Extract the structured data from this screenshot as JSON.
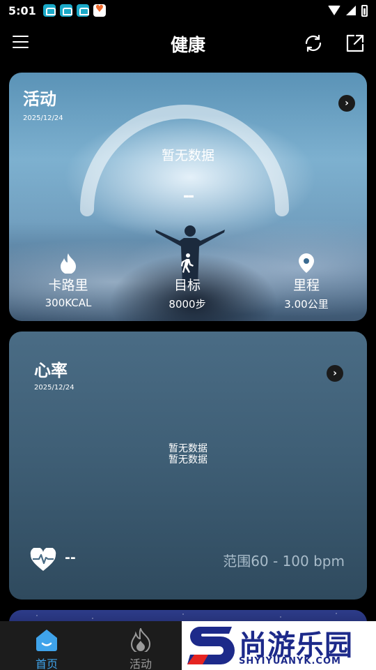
{
  "status_bar": {
    "time": "5:01"
  },
  "app_bar": {
    "title": "健康"
  },
  "activity_card": {
    "title": "活动",
    "date": "2025/12/24",
    "gauge_empty": "暂无数据",
    "gauge_value": "--",
    "stats": [
      {
        "label": "卡路里",
        "value": "300KCAL",
        "icon": "flame-icon"
      },
      {
        "label": "目标",
        "value": "8000步",
        "icon": "walking-icon"
      },
      {
        "label": "里程",
        "value": "3.00公里",
        "icon": "location-pin-icon"
      }
    ]
  },
  "heart_card": {
    "title": "心率",
    "date": "2025/12/24",
    "empty_1": "暂无数据",
    "empty_2": "暂无数据",
    "value": "--",
    "range": "范围60 - 100 bpm"
  },
  "bottom_nav": [
    {
      "label": "首页",
      "icon": "home-icon",
      "active": true
    },
    {
      "label": "活动",
      "icon": "flame-icon",
      "active": false
    }
  ],
  "watermark": {
    "title": "尚游乐园",
    "url": "SHYIYUANYK.COM"
  },
  "colors": {
    "nav_active": "#3fa3ea",
    "nav_inactive": "#9a9a9a",
    "nav_bg": "#1c1c1c"
  }
}
